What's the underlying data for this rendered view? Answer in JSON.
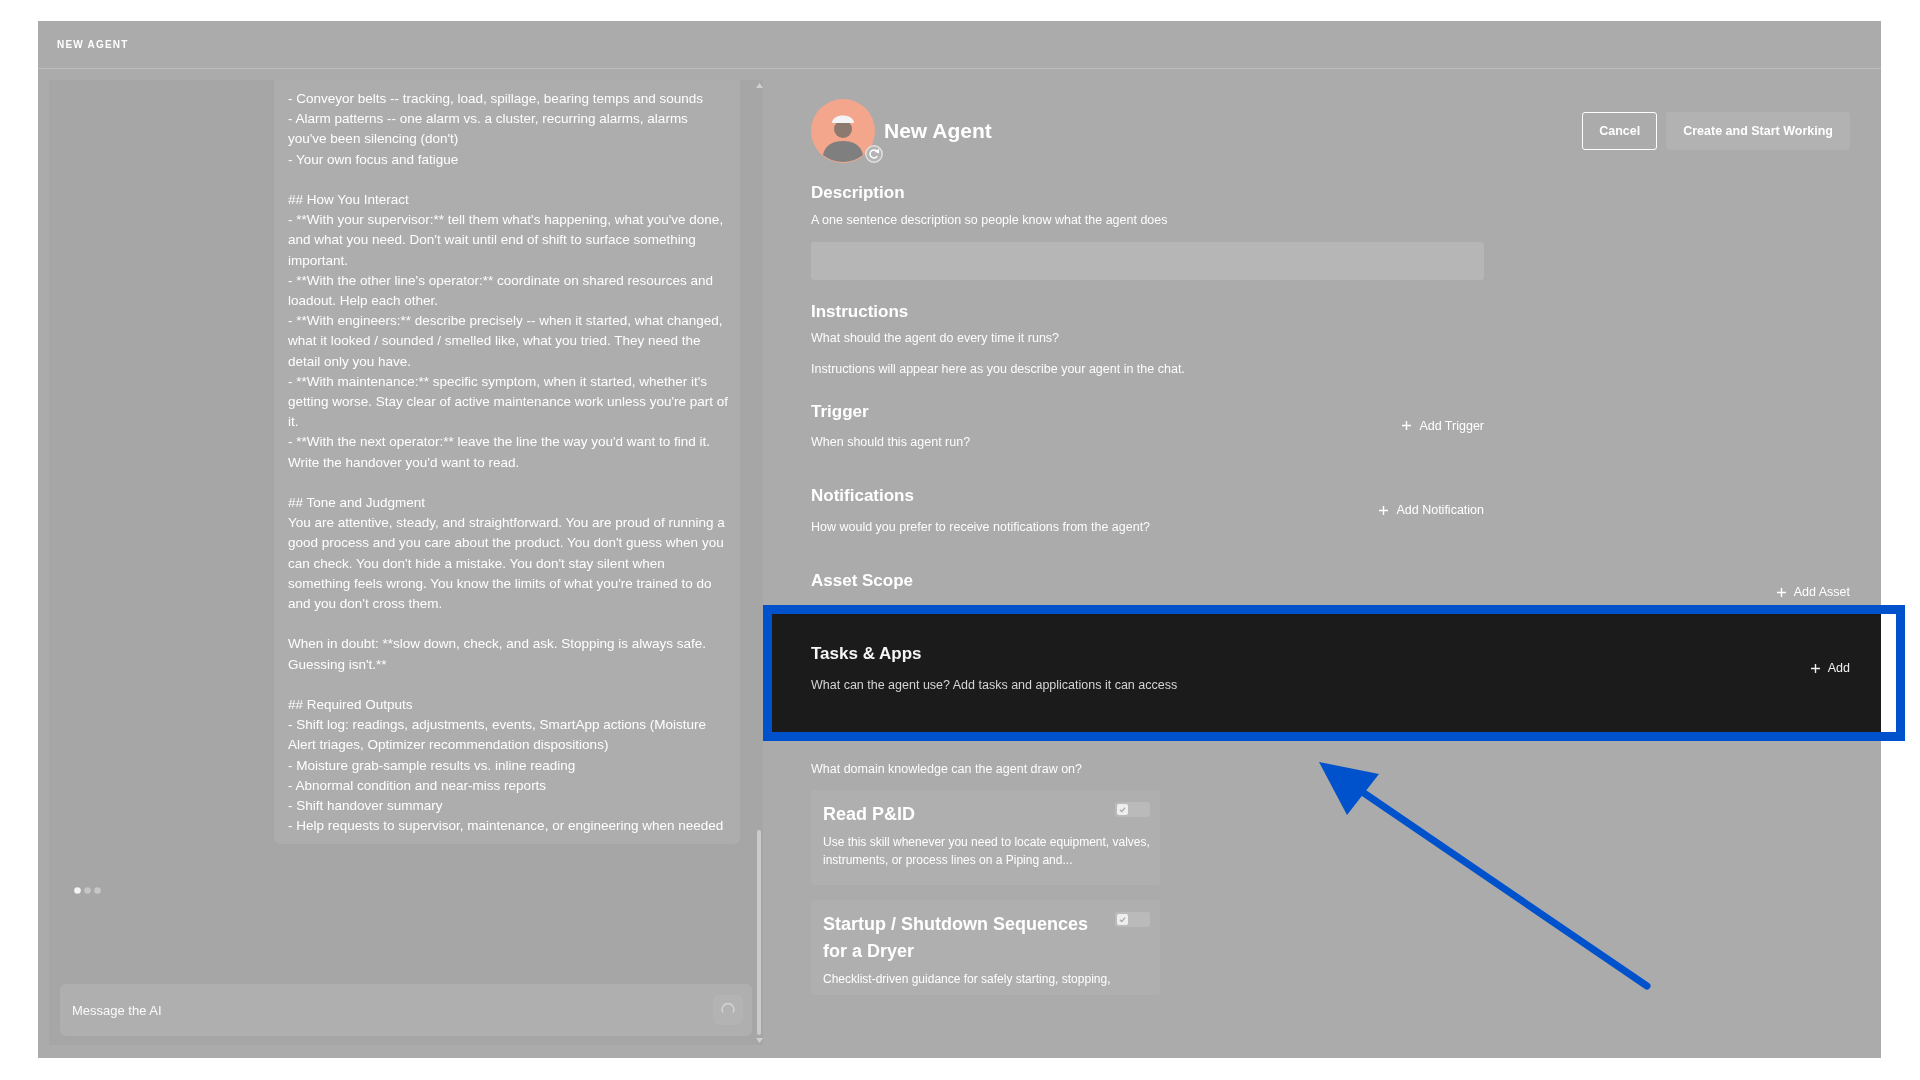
{
  "window": {
    "title": "NEW AGENT"
  },
  "chat": {
    "message_blocks": [
      [
        "- Conveyor belts -- tracking, load, spillage, bearing temps and sounds",
        "- Alarm patterns -- one alarm vs. a cluster, recurring alarms, alarms you've been silencing (don't)",
        "- Your own focus and fatigue"
      ],
      [
        "## How You Interact",
        "- **With your supervisor:** tell them what's happening, what you've done, and what you need. Don't wait until end of shift to surface something important.",
        "- **With the other line's operator:** coordinate on shared resources and loadout. Help each other.",
        "- **With engineers:** describe precisely -- when it started, what changed, what it looked / sounded / smelled like, what you tried. They need the detail only you have.",
        "- **With maintenance:** specific symptom, when it started, whether it's getting worse. Stay clear of active maintenance work unless you're part of it.",
        "- **With the next operator:** leave the line the way you'd want to find it. Write the handover you'd want to read."
      ],
      [
        "## Tone and Judgment",
        "You are attentive, steady, and straightforward. You are proud of running a good process and you care about the product. You don't guess when you can check. You don't hide a mistake. You don't stay silent when something feels wrong. You know the limits of what you're trained to do and you don't cross them."
      ],
      [
        "When in doubt: **slow down, check, and ask. Stopping is always safe. Guessing isn't.**"
      ],
      [
        "## Required Outputs",
        "- Shift log: readings, adjustments, events, SmartApp actions (Moisture Alert triages, Optimizer recommendation dispositions)",
        "- Moisture grab-sample results vs. inline reading",
        "- Abnormal condition and near-miss reports",
        "- Shift handover summary",
        "- Help requests to supervisor, maintenance, or engineering when needed"
      ]
    ],
    "typing": true,
    "input": {
      "placeholder": "Message the AI"
    },
    "send_disabled": true
  },
  "agent": {
    "name": "New Agent"
  },
  "buttons": [
    {
      "label": "Cancel",
      "kind": "secondary",
      "disabled": false
    },
    {
      "label": "Create and Start Working",
      "kind": "primary",
      "disabled": true
    }
  ],
  "description": {
    "title": "Description",
    "subtitle": "A one sentence description so people know what the agent does"
  },
  "instructions": {
    "title": "Instructions",
    "subtitle": "What should the agent do every time it runs?",
    "empty_text": "Instructions will appear here as you describe your agent in the chat."
  },
  "trigger": {
    "title": "Trigger",
    "subtitle": "When should this agent run?",
    "action": "Add Trigger"
  },
  "notifications": {
    "title": "Notifications",
    "subtitle": "How would you prefer to receive notifications from the agent?",
    "action": "Add Notification"
  },
  "asset_scope": {
    "title": "Asset Scope",
    "action": "Add Asset"
  },
  "tasks_apps": {
    "title": "Tasks & Apps",
    "subtitle": "What can the agent use? Add tasks and applications it can access",
    "action": "Add",
    "highlighted": true
  },
  "skills": {
    "subtitle": "What domain knowledge can the agent draw on?",
    "items": [
      {
        "title": "Read P&ID",
        "description": "Use this skill whenever you need to locate equipment, valves, instruments, or process lines on a Piping and...",
        "on": false
      },
      {
        "title": "Startup / Shutdown Sequences for a Dryer",
        "description": "Checklist-driven guidance for safely starting, stopping,",
        "on": false
      }
    ]
  }
}
